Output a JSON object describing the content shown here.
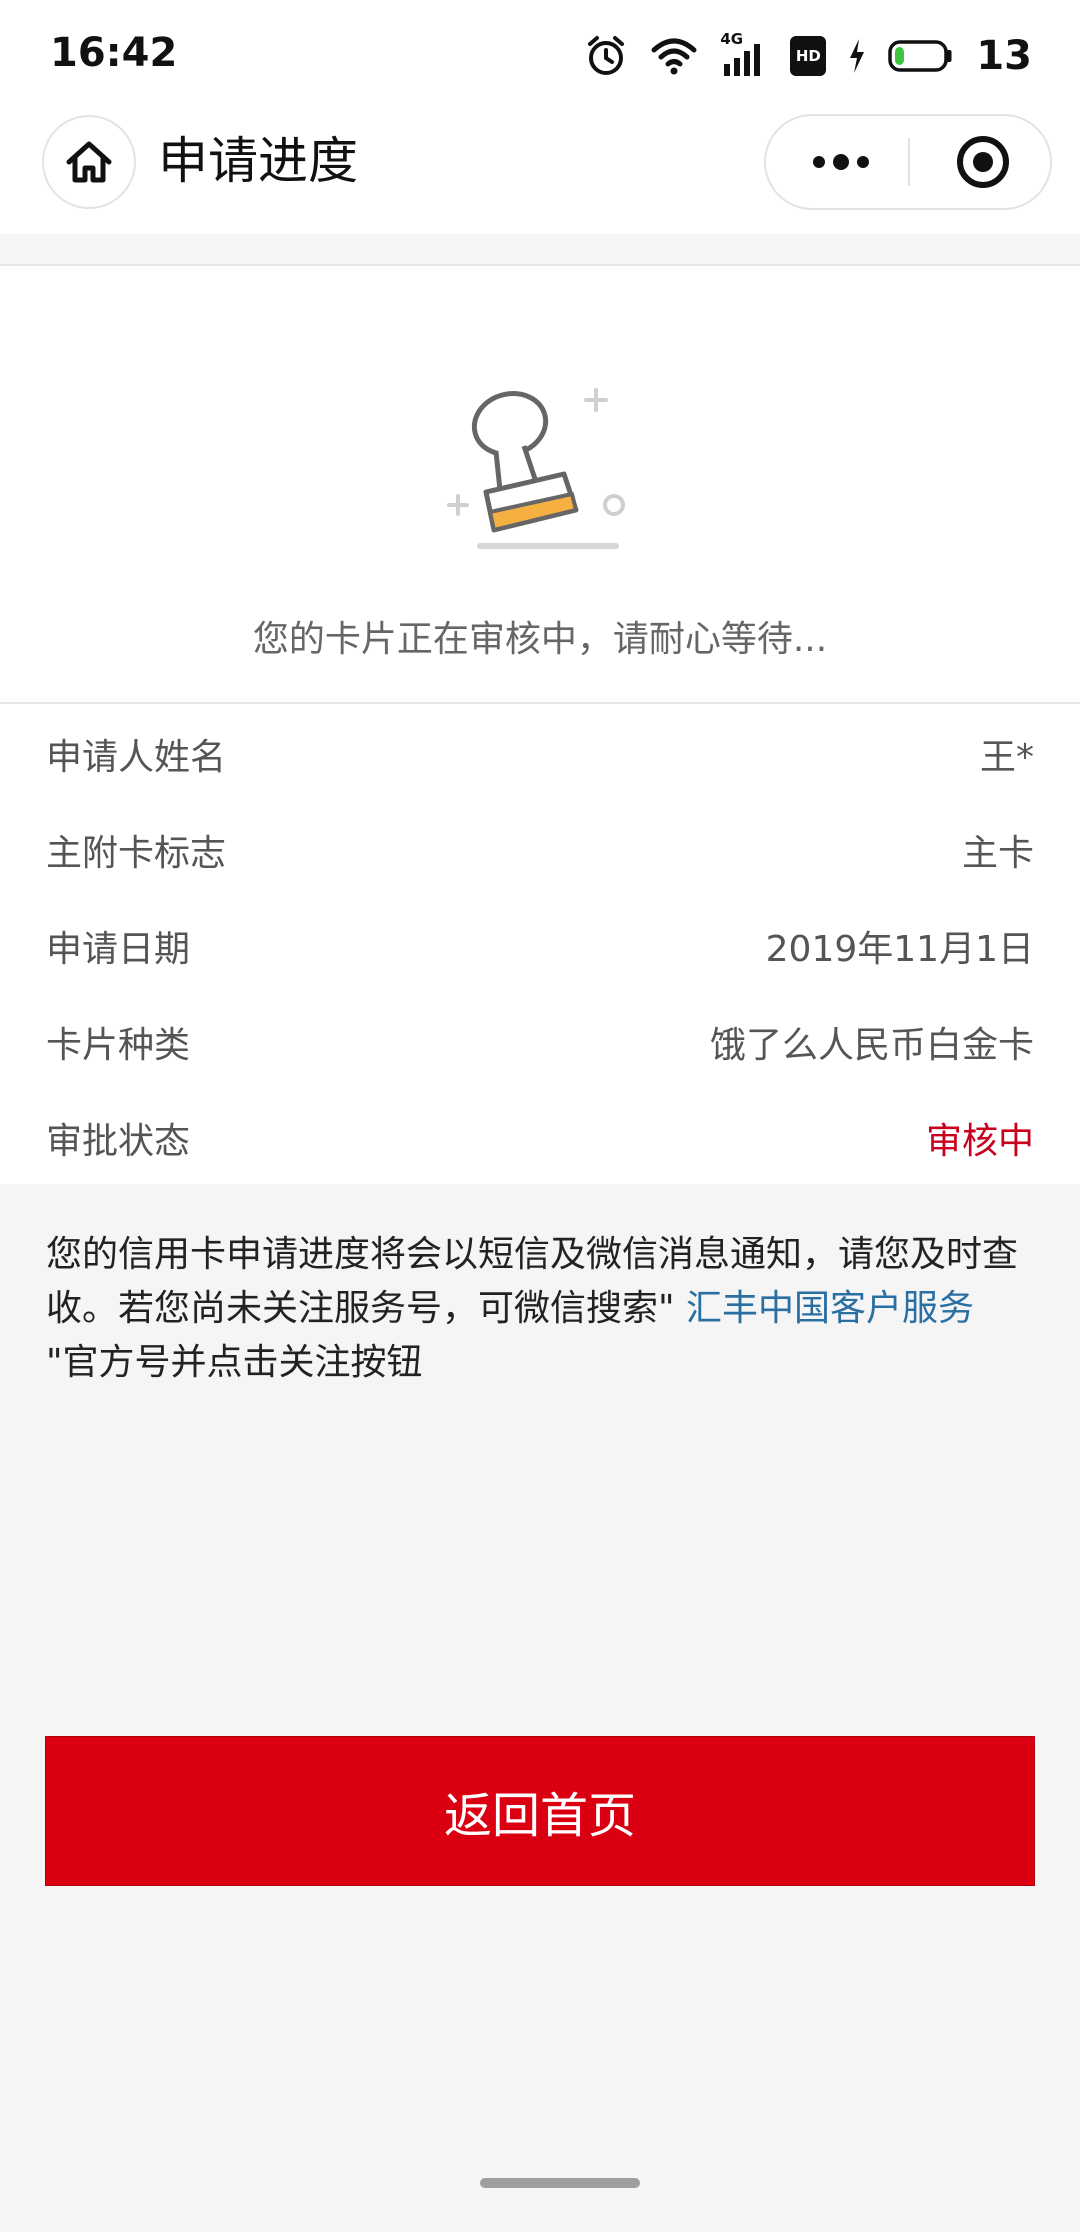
{
  "status_bar": {
    "time": "16:42",
    "battery_level": "13",
    "icons": [
      "alarm-icon",
      "wifi-icon",
      "signal-4g-icon",
      "hd-icon",
      "charging-icon",
      "battery-icon"
    ],
    "network": "4G",
    "hd": "HD"
  },
  "header": {
    "title": "申请进度",
    "home_icon": "home-icon",
    "more_icon": "more-dots-icon",
    "close_icon": "target-close-icon"
  },
  "status_panel": {
    "illustration": "stamp-icon",
    "message": "您的卡片正在审核中，请耐心等待..."
  },
  "info": {
    "rows": [
      {
        "label": "申请人姓名",
        "value": "王*"
      },
      {
        "label": "主附卡标志",
        "value": "主卡"
      },
      {
        "label": "申请日期",
        "value": "2019年11月1日"
      },
      {
        "label": "卡片种类",
        "value": "饿了么人民币白金卡"
      },
      {
        "label": "审批状态",
        "value": "审核中"
      }
    ]
  },
  "notice": {
    "before": "您的信用卡申请进度将会以短信及微信消息通知，请您及时查收。若您尚未关注服务号，可微信搜索\" ",
    "link": "汇丰中国客户服务",
    "after": " \"官方号并点击关注按钮"
  },
  "button": {
    "label": "返回首页"
  },
  "colors": {
    "brand_red": "#db0011",
    "status_red": "#c8001e",
    "link_blue": "#2a6fa2",
    "stamp_orange": "#f5b041"
  }
}
